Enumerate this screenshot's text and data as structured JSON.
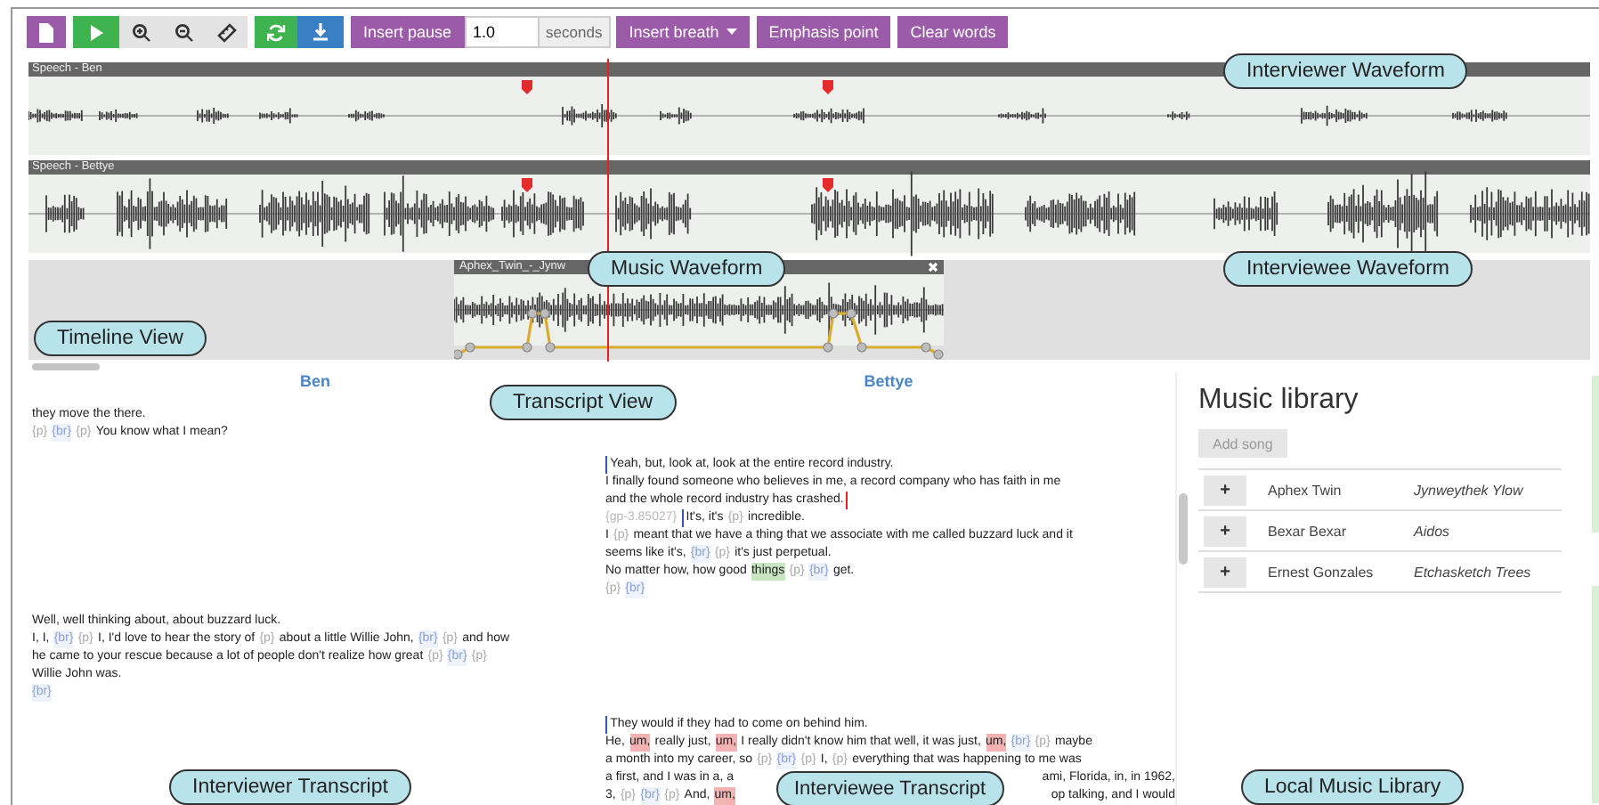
{
  "toolbar": [
    {
      "kind": "file",
      "color": "#9c5ba8"
    },
    {
      "kind": "play",
      "color": "#3fb34f"
    },
    {
      "kind": "zoom-in",
      "color": "#e3e3e3"
    },
    {
      "kind": "zoom-out",
      "color": "#e3e3e3"
    },
    {
      "kind": "ruler",
      "color": "#e3e3e3"
    },
    {
      "kind": "refresh",
      "color": "#3fb34f"
    },
    {
      "kind": "download",
      "color": "#3a7fc4"
    },
    {
      "kind": "text",
      "label": "Insert pause",
      "color": "#9c5ba8"
    },
    {
      "kind": "number-field",
      "value": "1.0",
      "unit": "seconds"
    },
    {
      "kind": "dropdown",
      "label": "Insert breath",
      "color": "#9c5ba8"
    },
    {
      "kind": "text",
      "label": "Emphasis point",
      "color": "#9c5ba8"
    },
    {
      "kind": "text",
      "label": "Clear words",
      "color": "#9c5ba8"
    }
  ],
  "tracks": [
    {
      "title": "Speech - Ben",
      "kind": "interviewer"
    },
    {
      "title": "Speech - Bettye",
      "kind": "interviewee"
    }
  ],
  "music_clip": {
    "title": "Aphex_Twin_-_Jynw"
  },
  "transcript": {
    "speakers": [
      {
        "name": "Ben"
      },
      {
        "name": "Bettye"
      }
    ],
    "turns": [
      {
        "kind": "interviewer",
        "lines": [
          [
            {
              "kind": "text",
              "text": "they move the there."
            }
          ],
          [
            {
              "kind": "pause",
              "text": "{p}"
            },
            {
              "kind": "breath",
              "text": "{br}"
            },
            {
              "kind": "pause",
              "text": "{p}"
            },
            {
              "kind": "text",
              "text": "You know what I mean?"
            }
          ]
        ]
      },
      {
        "kind": "interviewee",
        "lines": [
          [
            {
              "kind": "start-mark"
            },
            {
              "kind": "text",
              "text": "Yeah, but, look at, look at the entire record industry."
            }
          ],
          [
            {
              "kind": "text",
              "text": "I finally found someone who believes in me, a record company who has faith in me"
            }
          ],
          [
            {
              "kind": "text",
              "text": "and the whole record industry has crashed."
            },
            {
              "kind": "end-mark"
            }
          ],
          [
            {
              "kind": "gap",
              "text": "{gp-3.85027}"
            },
            {
              "kind": "start-mark"
            },
            {
              "kind": "text",
              "text": "It's, it's"
            },
            {
              "kind": "pause",
              "text": "{p}"
            },
            {
              "kind": "text",
              "text": "incredible."
            }
          ],
          [
            {
              "kind": "text",
              "text": "I"
            },
            {
              "kind": "pause",
              "text": "{p}"
            },
            {
              "kind": "text",
              "text": "meant that we have a thing that we associate with me called buzzard luck and it"
            }
          ],
          [
            {
              "kind": "text",
              "text": "seems like it's,"
            },
            {
              "kind": "breath",
              "text": "{br}"
            },
            {
              "kind": "pause",
              "text": "{p}"
            },
            {
              "kind": "text",
              "text": "it's just perpetual."
            }
          ],
          [
            {
              "kind": "text",
              "text": "No matter how, how good"
            },
            {
              "kind": "emphasis",
              "text": "things"
            },
            {
              "kind": "pause",
              "text": "{p}"
            },
            {
              "kind": "breath",
              "text": "{br}"
            },
            {
              "kind": "text",
              "text": "get."
            }
          ],
          [
            {
              "kind": "pause",
              "text": "{p}"
            },
            {
              "kind": "breath",
              "text": "{br}"
            }
          ]
        ]
      },
      {
        "kind": "interviewer",
        "lines": [
          [
            {
              "kind": "text",
              "text": "Well, well thinking about, about buzzard luck."
            }
          ],
          [
            {
              "kind": "text",
              "text": "I, I,"
            },
            {
              "kind": "breath",
              "text": "{br}"
            },
            {
              "kind": "pause",
              "text": "{p}"
            },
            {
              "kind": "text",
              "text": "I, I'd love to hear the story of"
            },
            {
              "kind": "pause",
              "text": "{p}"
            },
            {
              "kind": "text",
              "text": "about a little Willie John,"
            },
            {
              "kind": "breath",
              "text": "{br}"
            },
            {
              "kind": "pause",
              "text": "{p}"
            },
            {
              "kind": "text",
              "text": "and how"
            }
          ],
          [
            {
              "kind": "text",
              "text": "he came to your rescue because a lot of people don't realize how great"
            },
            {
              "kind": "pause",
              "text": "{p}"
            },
            {
              "kind": "breath",
              "text": "{br}"
            },
            {
              "kind": "pause",
              "text": "{p}"
            }
          ],
          [
            {
              "kind": "text",
              "text": "Willie John was."
            }
          ],
          [
            {
              "kind": "breath",
              "text": "{br}"
            }
          ]
        ]
      },
      {
        "kind": "interviewee",
        "lines": [
          [
            {
              "kind": "start-mark"
            },
            {
              "kind": "text",
              "text": "They would if they had to come on behind him."
            }
          ],
          [
            {
              "kind": "text",
              "text": "He,"
            },
            {
              "kind": "filler",
              "text": "um,"
            },
            {
              "kind": "text",
              "text": "really just,"
            },
            {
              "kind": "filler",
              "text": "um,"
            },
            {
              "kind": "text",
              "text": "I really didn't know him that well, it was just,"
            },
            {
              "kind": "filler",
              "text": "um,"
            },
            {
              "kind": "breath",
              "text": "{br}"
            },
            {
              "kind": "pause",
              "text": "{p}"
            },
            {
              "kind": "text",
              "text": "maybe"
            }
          ],
          [
            {
              "kind": "text",
              "text": "a month into my career, so"
            },
            {
              "kind": "pause",
              "text": "{p}"
            },
            {
              "kind": "breath",
              "text": "{br}"
            },
            {
              "kind": "pause",
              "text": "{p}"
            },
            {
              "kind": "text",
              "text": "I,"
            },
            {
              "kind": "pause",
              "text": "{p}"
            },
            {
              "kind": "text",
              "text": "everything that was happening to me was"
            }
          ],
          [
            {
              "kind": "text",
              "text": "a first, and I was in a, a"
            },
            {
              "kind": "covered"
            },
            {
              "kind": "text",
              "text": "ami, Florida, in, in 1962,"
            }
          ],
          [
            {
              "kind": "text",
              "text": "3,"
            },
            {
              "kind": "pause",
              "text": "{p}"
            },
            {
              "kind": "breath",
              "text": "{br}"
            },
            {
              "kind": "pause",
              "text": "{p}"
            },
            {
              "kind": "text",
              "text": "And,"
            },
            {
              "kind": "filler",
              "text": "um,"
            },
            {
              "kind": "covered"
            },
            {
              "kind": "text",
              "text": "op talking, and I would"
            }
          ]
        ]
      }
    ]
  },
  "music_library": {
    "title": "Music library",
    "add_button": {
      "label": "Add song",
      "disabled": true
    },
    "songs": [
      {
        "button": "+",
        "artist": "Aphex Twin",
        "title": "Jynweythek Ylow"
      },
      {
        "button": "+",
        "artist": "Bexar Bexar",
        "title": "Aidos"
      },
      {
        "button": "+",
        "artist": "Ernest Gonzales",
        "title": "Etchasketch Trees"
      }
    ]
  },
  "callouts": [
    {
      "text": "Interviewer Waveform"
    },
    {
      "text": "Music Waveform"
    },
    {
      "text": "Interviewee Waveform"
    },
    {
      "text": "Timeline View"
    },
    {
      "text": "Transcript View"
    },
    {
      "text": "Interviewer Transcript"
    },
    {
      "text": "Interviewee Transcript"
    },
    {
      "text": "Local Music Library"
    }
  ]
}
